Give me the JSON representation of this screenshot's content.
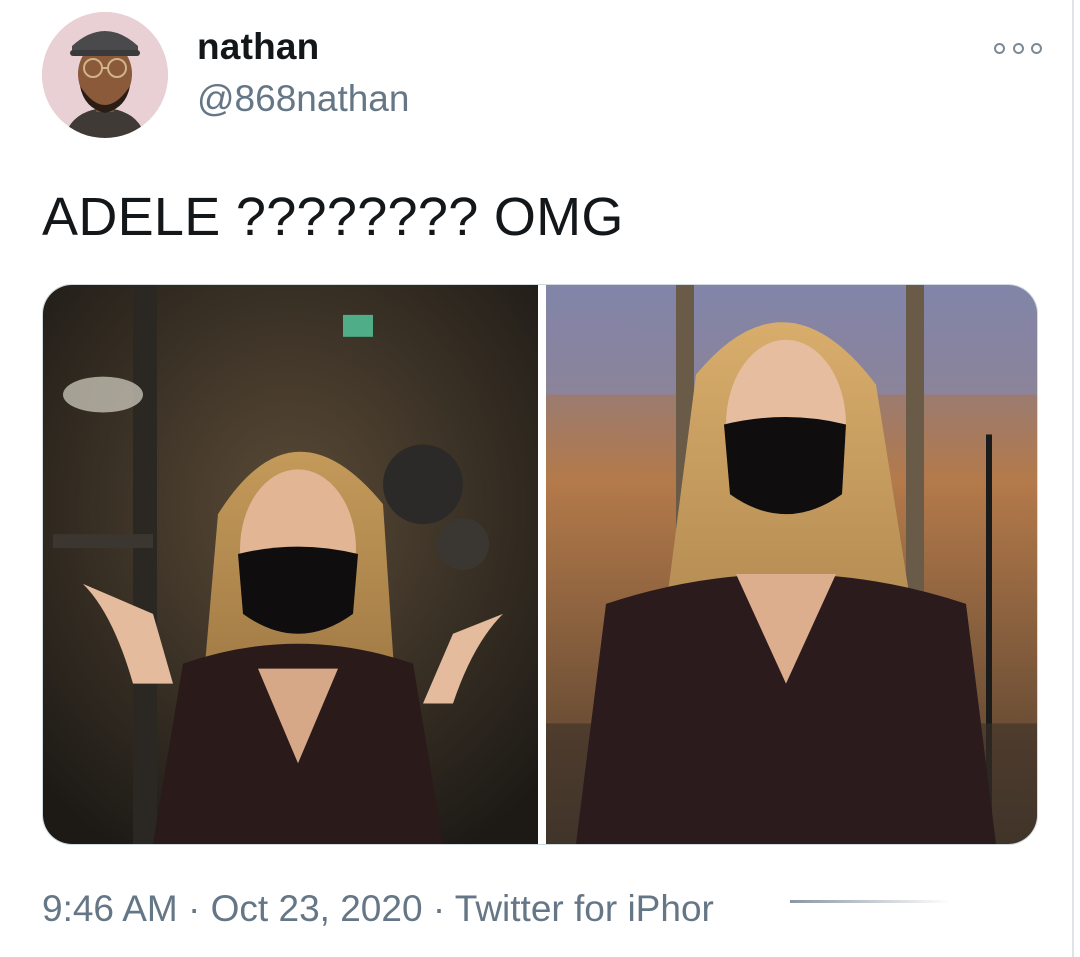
{
  "user": {
    "display_name": "nathan",
    "handle": "@868nathan",
    "avatar_icon": "avatar-photo"
  },
  "tweet": {
    "text": "ADELE ???????? OMG"
  },
  "media": {
    "photos": [
      {
        "alt_icon": "photo-left"
      },
      {
        "alt_icon": "photo-right"
      }
    ]
  },
  "meta": {
    "time": "9:46 AM",
    "separator": "·",
    "date": "Oct 23, 2020",
    "source": "Twitter for iPhor"
  },
  "colors": {
    "text": "#14171a",
    "secondary": "#657786",
    "border": "#cfd9de"
  },
  "icons": {
    "more": "more-options-icon"
  }
}
